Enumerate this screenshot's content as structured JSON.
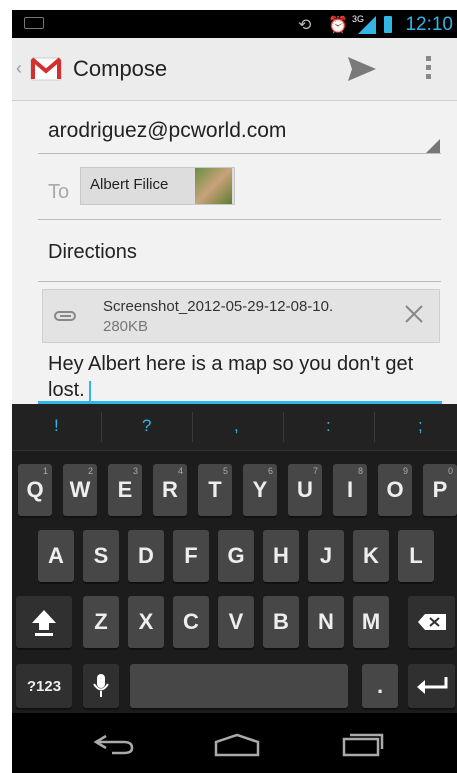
{
  "status_bar": {
    "time": "12:10",
    "network": "3G"
  },
  "action_bar": {
    "title": "Compose",
    "send_icon": "send-icon",
    "overflow_icon": "overflow-menu-icon"
  },
  "compose": {
    "from": "arodriguez@pcworld.com",
    "to_label": "To",
    "recipient_name": "Albert Filice",
    "subject": "Directions",
    "attachment": {
      "name": "Screenshot_2012-05-29-12-08-10.",
      "size": "280KB"
    },
    "body": "Hey Albert here is a map so you don't get lost."
  },
  "keyboard": {
    "suggestions": [
      "!",
      "?",
      ",",
      ":",
      ";"
    ],
    "row1": [
      {
        "label": "Q",
        "hint": "1"
      },
      {
        "label": "W",
        "hint": "2"
      },
      {
        "label": "E",
        "hint": "3"
      },
      {
        "label": "R",
        "hint": "4"
      },
      {
        "label": "T",
        "hint": "5"
      },
      {
        "label": "Y",
        "hint": "6"
      },
      {
        "label": "U",
        "hint": "7"
      },
      {
        "label": "I",
        "hint": "8"
      },
      {
        "label": "O",
        "hint": "9"
      },
      {
        "label": "P",
        "hint": "0"
      }
    ],
    "row2": [
      "A",
      "S",
      "D",
      "F",
      "G",
      "H",
      "J",
      "K",
      "L"
    ],
    "row3": [
      "Z",
      "X",
      "C",
      "V",
      "B",
      "N",
      "M"
    ],
    "symbols_label": "?123",
    "period_label": "."
  },
  "accent_color": "#33b5e5"
}
